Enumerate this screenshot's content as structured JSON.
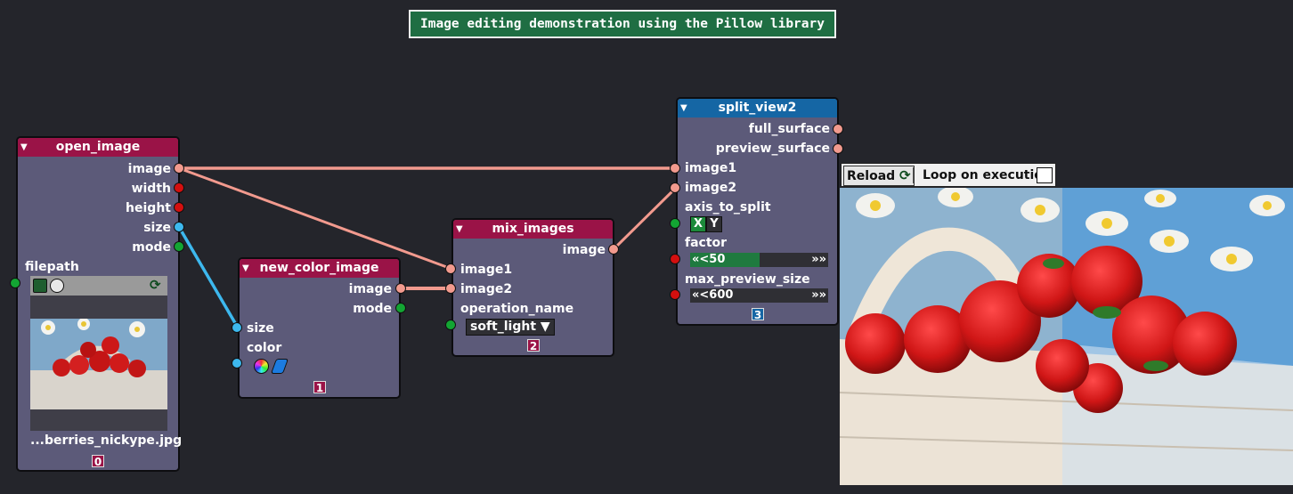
{
  "text_block": "Image editing demonstration using the Pillow library",
  "nodes": {
    "open_image": {
      "title": "open_image",
      "outputs": [
        "image",
        "width",
        "height",
        "size",
        "mode"
      ],
      "input_label": "filepath",
      "filename": "...berries_nickype.jpg",
      "index": "0"
    },
    "new_color_image": {
      "title": "new_color_image",
      "outputs": [
        "image",
        "mode"
      ],
      "inputs": [
        "size",
        "color"
      ],
      "index": "1"
    },
    "mix_images": {
      "title": "mix_images",
      "outputs": [
        "image"
      ],
      "inputs": [
        "image1",
        "image2",
        "operation_name"
      ],
      "operation_value": "soft_light ▼",
      "index": "2"
    },
    "split_view2": {
      "title": "split_view2",
      "outputs": [
        "full_surface",
        "preview_surface"
      ],
      "inputs": [
        "image1",
        "image2",
        "axis_to_split",
        "factor",
        "max_preview_size"
      ],
      "axis_options": [
        "X",
        "Y"
      ],
      "axis_selected": "X",
      "factor_text": "«<50",
      "factor_fraction": 0.5,
      "max_preview_text": "«<600",
      "arrows": "»»",
      "index": "3"
    }
  },
  "preview": {
    "reload_label": "Reload",
    "loop_label": "Loop on execution"
  },
  "colors": {
    "background": "#24252b",
    "node_body": "#5c5a79",
    "header_red": "#9a1347",
    "header_blue": "#1566a4",
    "text_block_bg": "#1f6e43",
    "wire_pink": "#f29a8e",
    "wire_blue": "#3db8ee"
  },
  "icons": [
    "collapse-triangle-icon",
    "folder-open-icon",
    "image-view-icon",
    "reload-icon",
    "color-wheel-icon",
    "color-picker-icon",
    "checkbox-icon"
  ]
}
